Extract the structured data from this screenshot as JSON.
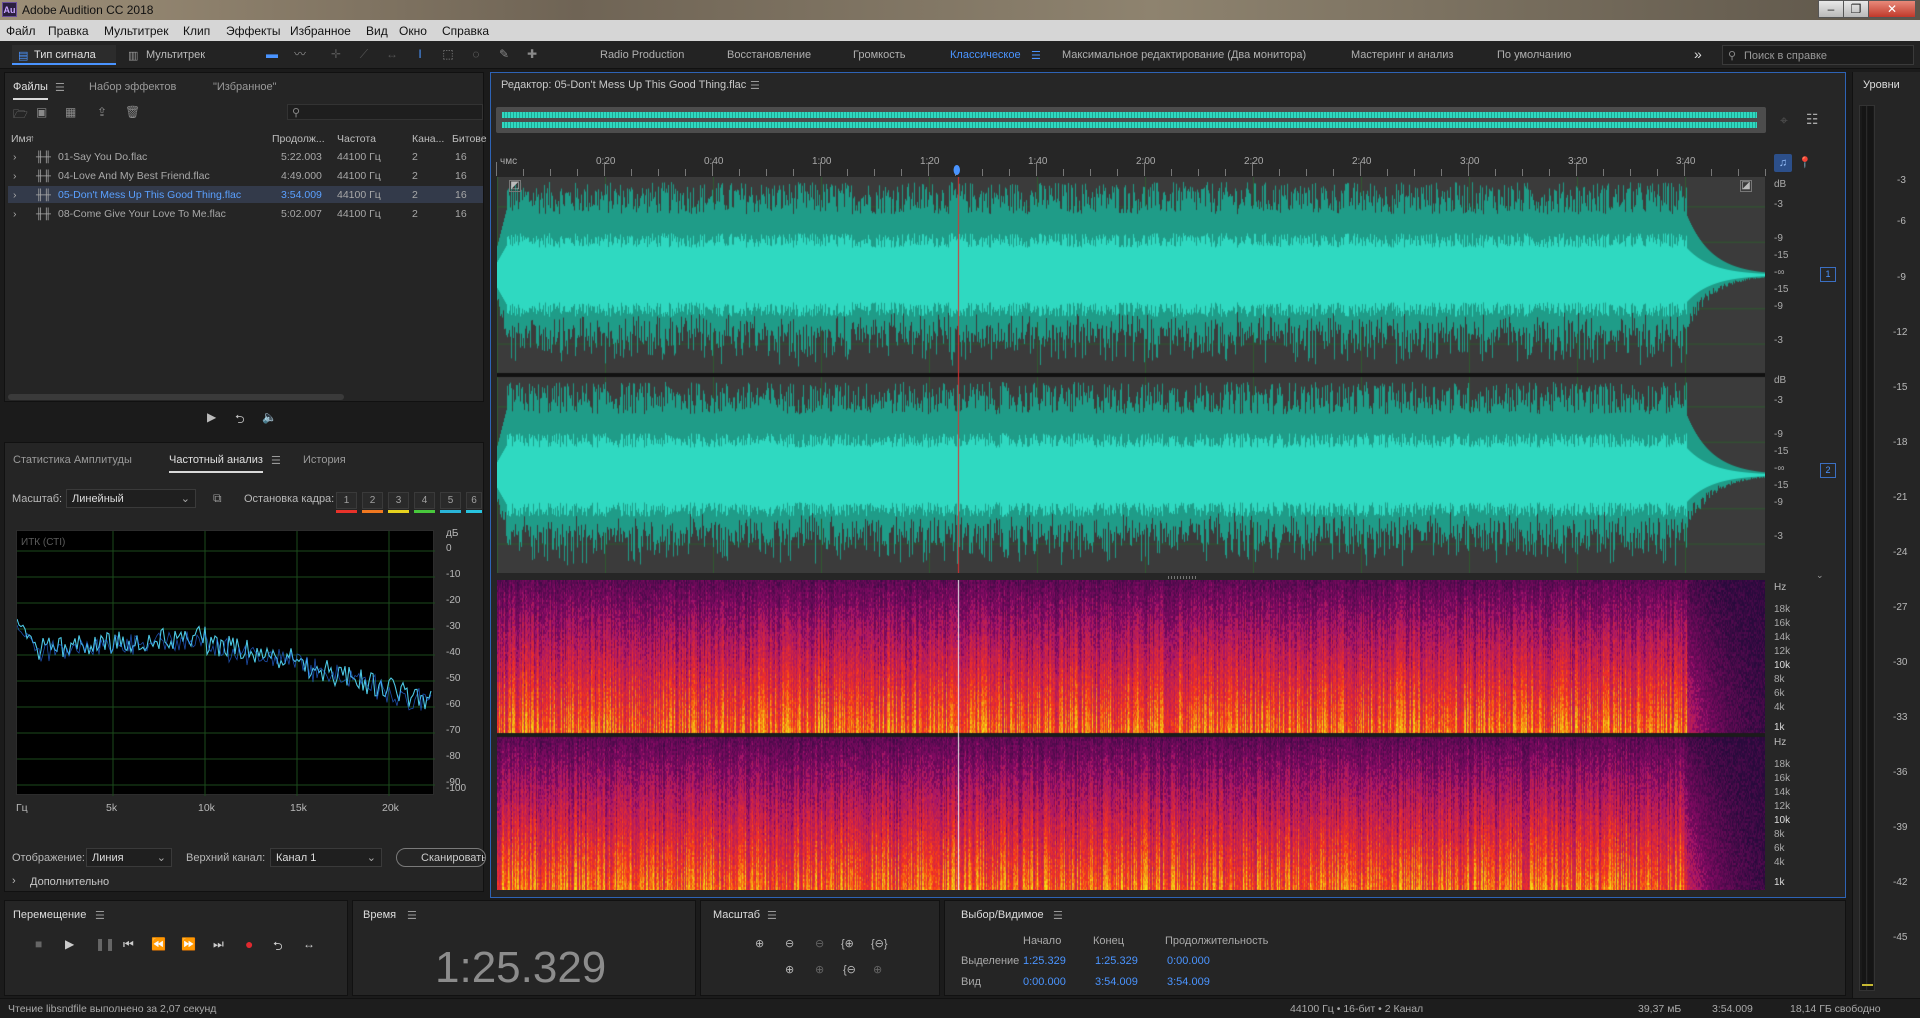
{
  "window": {
    "title": "Adobe Audition CC 2018",
    "logo": "Au"
  },
  "menu": [
    "Файл",
    "Правка",
    "Мультитрек",
    "Клип",
    "Эффекты",
    "Избранное",
    "Вид",
    "Окно",
    "Справка"
  ],
  "toolbar": {
    "mode_waveform": "Тип сигнала",
    "mode_multitrack": "Мультитрек",
    "workspaces": [
      "Radio Production",
      "Восстановление",
      "Громкость",
      "Классическое",
      "Максимальное редактирование (Два монитора)",
      "Мастеринг и анализ",
      "По умолчанию"
    ],
    "active_workspace": "Классическое",
    "more": "»",
    "search_placeholder": "Поиск в справке"
  },
  "files_panel": {
    "tabs": [
      "Файлы",
      "Набор эффектов",
      "\"Избранное\""
    ],
    "columns": [
      "Имя",
      "Продолж...",
      "Частота",
      "Кана...",
      "Битове"
    ],
    "rows": [
      {
        "name": "01-Say You Do.flac",
        "duration": "5:22.003",
        "rate": "44100 Гц",
        "channels": "2",
        "bits": "16",
        "selected": false
      },
      {
        "name": "04-Love And My Best Friend.flac",
        "duration": "4:49.000",
        "rate": "44100 Гц",
        "channels": "2",
        "bits": "16",
        "selected": false
      },
      {
        "name": "05-Don't Mess Up This Good Thing.flac",
        "duration": "3:54.009",
        "rate": "44100 Гц",
        "channels": "2",
        "bits": "16",
        "selected": true
      },
      {
        "name": "08-Come Give Your Love To Me.flac",
        "duration": "5:02.007",
        "rate": "44100 Гц",
        "channels": "2",
        "bits": "16",
        "selected": false
      }
    ]
  },
  "analysis_panel": {
    "tabs": [
      "Статистика Амплитуды",
      "Частотный анализ",
      "История"
    ],
    "scale_label": "Масштаб:",
    "scale_value": "Линейный",
    "freeze_label": "Остановка кадра:",
    "freeze_buttons": [
      "1",
      "2",
      "3",
      "4",
      "5",
      "6"
    ],
    "freeze_colors": [
      "#e8322a",
      "#f07820",
      "#e6d21e",
      "#48c83c",
      "#2ab4d8",
      "#28c4e0"
    ],
    "graph_label": "ИТК (СТІ)",
    "db_unit": "дБ",
    "db_ticks": [
      "0",
      "-10",
      "-20",
      "-30",
      "-40",
      "-50",
      "-60",
      "-70",
      "-80",
      "-90",
      "-100"
    ],
    "freq_ticks": [
      "Гц",
      "5k",
      "10k",
      "15k",
      "20k"
    ],
    "display_label": "Отображение:",
    "display_value": "Линия",
    "top_channel_label": "Верхний канал:",
    "top_channel_value": "Канал 1",
    "scan_button": "Сканировать",
    "advanced": "Дополнительно"
  },
  "editor": {
    "title": "Редактор: 05-Don't Mess Up This Good Thing.flac",
    "ruler": [
      "чмс",
      "0:20",
      "0:40",
      "1:00",
      "1:20",
      "1:40",
      "2:00",
      "2:20",
      "2:40",
      "3:00",
      "3:20",
      "3:40"
    ],
    "db_scale": [
      "dB",
      "-3",
      "-9",
      "-15",
      "-∞",
      "-15",
      "-9",
      "-3"
    ],
    "channel_badges": [
      "1",
      "2"
    ],
    "hz_scale": [
      "Hz",
      "18k",
      "16k",
      "14k",
      "12k",
      "10k",
      "8k",
      "6k",
      "4k",
      "1k"
    ]
  },
  "levels_panel": {
    "title": "Уровни",
    "ticks": [
      "-3",
      "-6",
      "-9",
      "-12",
      "-15",
      "-18",
      "-21",
      "-24",
      "-27",
      "-30",
      "-33",
      "-36",
      "-39",
      "-42",
      "-45"
    ]
  },
  "transport": {
    "title": "Перемещение"
  },
  "time_panel": {
    "title": "Время",
    "value": "1:25.329"
  },
  "zoom_panel": {
    "title": "Масштаб"
  },
  "selection_panel": {
    "title": "Выбор/Видимое",
    "headers": [
      "Начало",
      "Конец",
      "Продолжительность"
    ],
    "selection_label": "Выделение",
    "selection": [
      "1:25.329",
      "1:25.329",
      "0:00.000"
    ],
    "view_label": "Вид",
    "view": [
      "0:00.000",
      "3:54.009",
      "3:54.009"
    ]
  },
  "status": {
    "message": "Чтение libsndfile выполнено за 2,07 секунд",
    "format": "44100 Гц • 16-бит • 2 Канал",
    "size": "39,37 мБ",
    "duration": "3:54.009",
    "free": "18,14 ГБ свободно"
  }
}
